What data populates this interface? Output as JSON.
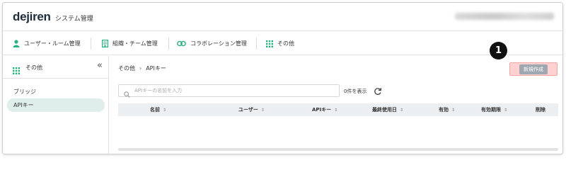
{
  "header": {
    "brand": "dejiren",
    "app_title": "システム管理",
    "user_info": "○○○○○○○○○○○○○ ○○○ ○○○○○○○○"
  },
  "nav": {
    "items": [
      {
        "label": "ユーザー・ルーム管理",
        "icon": "user-icon"
      },
      {
        "label": "組織・チーム管理",
        "icon": "building-icon"
      },
      {
        "label": "コラボレーション管理",
        "icon": "link-icon"
      },
      {
        "label": "その他",
        "icon": "grid-icon"
      }
    ]
  },
  "sidebar": {
    "title": "その他",
    "collapse_glyph": "«",
    "items": [
      {
        "label": "ブリッジ",
        "active": false
      },
      {
        "label": "APIキー",
        "active": true
      }
    ]
  },
  "main": {
    "breadcrumb": {
      "parent": "その他",
      "separator": "›",
      "current": "APIキー"
    },
    "new_button_label": "新規作成",
    "step_badge": "1",
    "search_placeholder": "APIキーの名前を入力",
    "count_text": "0件を表示",
    "table": {
      "columns": [
        {
          "label": "名前",
          "sort": "⇕"
        },
        {
          "label": "ユーザー",
          "sort": "⇕"
        },
        {
          "label": "APIキー",
          "sort": "⇕"
        },
        {
          "label": "最終使用日",
          "sort": "⇕"
        },
        {
          "label": "有効",
          "sort": "⇕"
        },
        {
          "label": "有効期限",
          "sort": "⇕"
        },
        {
          "label": "削除",
          "sort": ""
        }
      ],
      "rows": []
    }
  },
  "colors": {
    "accent_green": "#2bb07f",
    "active_item_bg": "#dfeeea",
    "highlight_red": "#ffd1d1",
    "table_header_bg": "#eceff1"
  }
}
